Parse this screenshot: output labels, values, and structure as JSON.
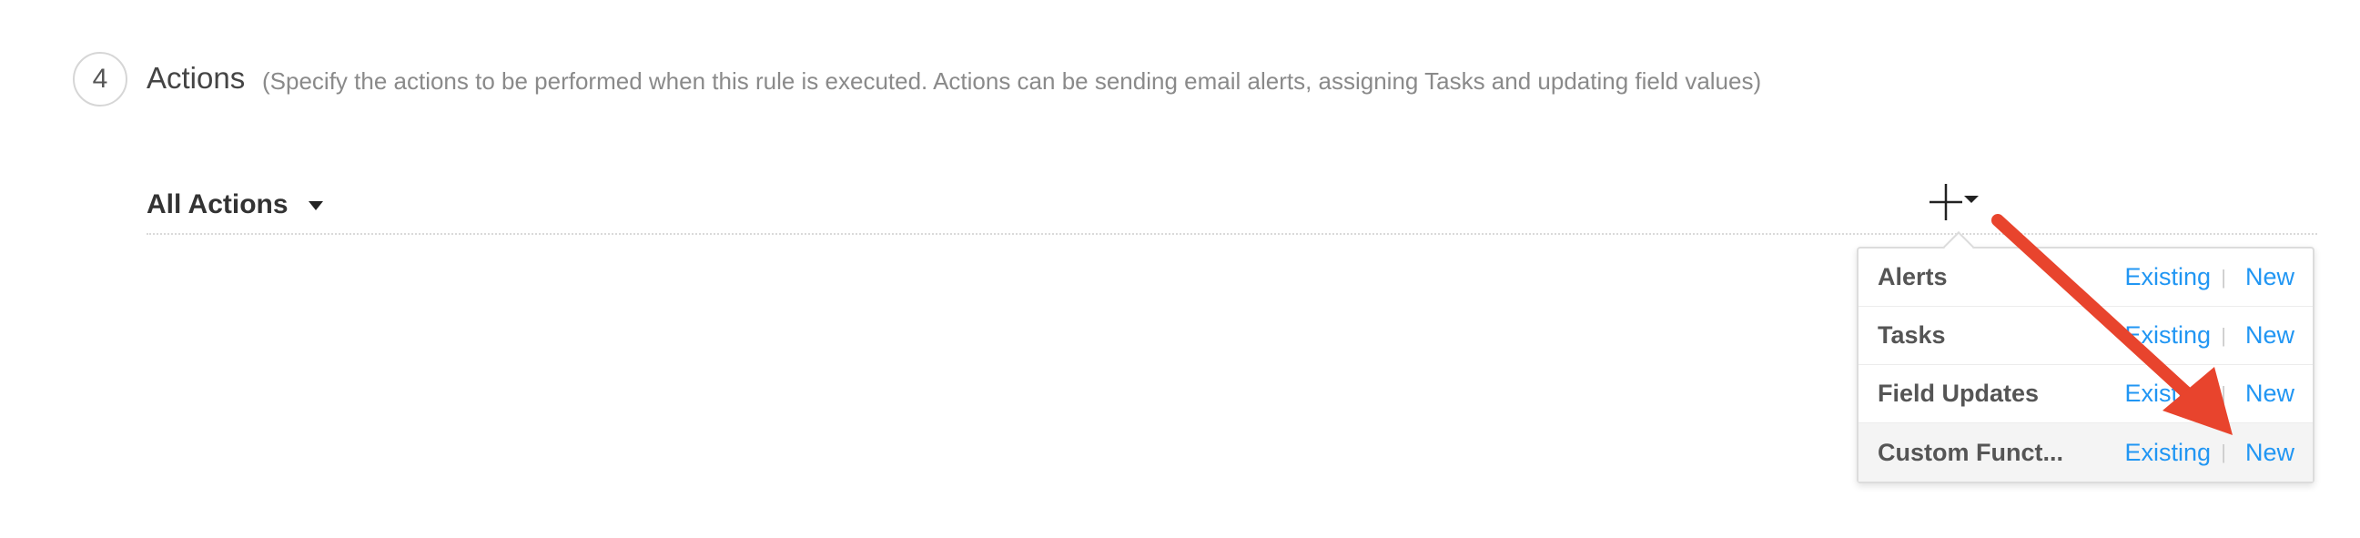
{
  "section": {
    "step_number": "4",
    "title": "Actions",
    "description": "(Specify the actions to be performed when this rule is executed. Actions can be sending email alerts, assigning Tasks and updating field values)"
  },
  "filter": {
    "label": "All Actions"
  },
  "add_button": {
    "icon": "plus-icon"
  },
  "dropdown": {
    "rows": [
      {
        "label": "Alerts",
        "existing": "Existing",
        "new": "New"
      },
      {
        "label": "Tasks",
        "existing": "Existing",
        "new": "New"
      },
      {
        "label": "Field Updates",
        "existing": "Existing",
        "new": "New"
      },
      {
        "label": "Custom Funct...",
        "existing": "Existing",
        "new": "New"
      }
    ],
    "separator": "|"
  },
  "colors": {
    "link": "#2196f3",
    "arrow": "#e8442d",
    "highlight_row": "#f4f4f4"
  }
}
